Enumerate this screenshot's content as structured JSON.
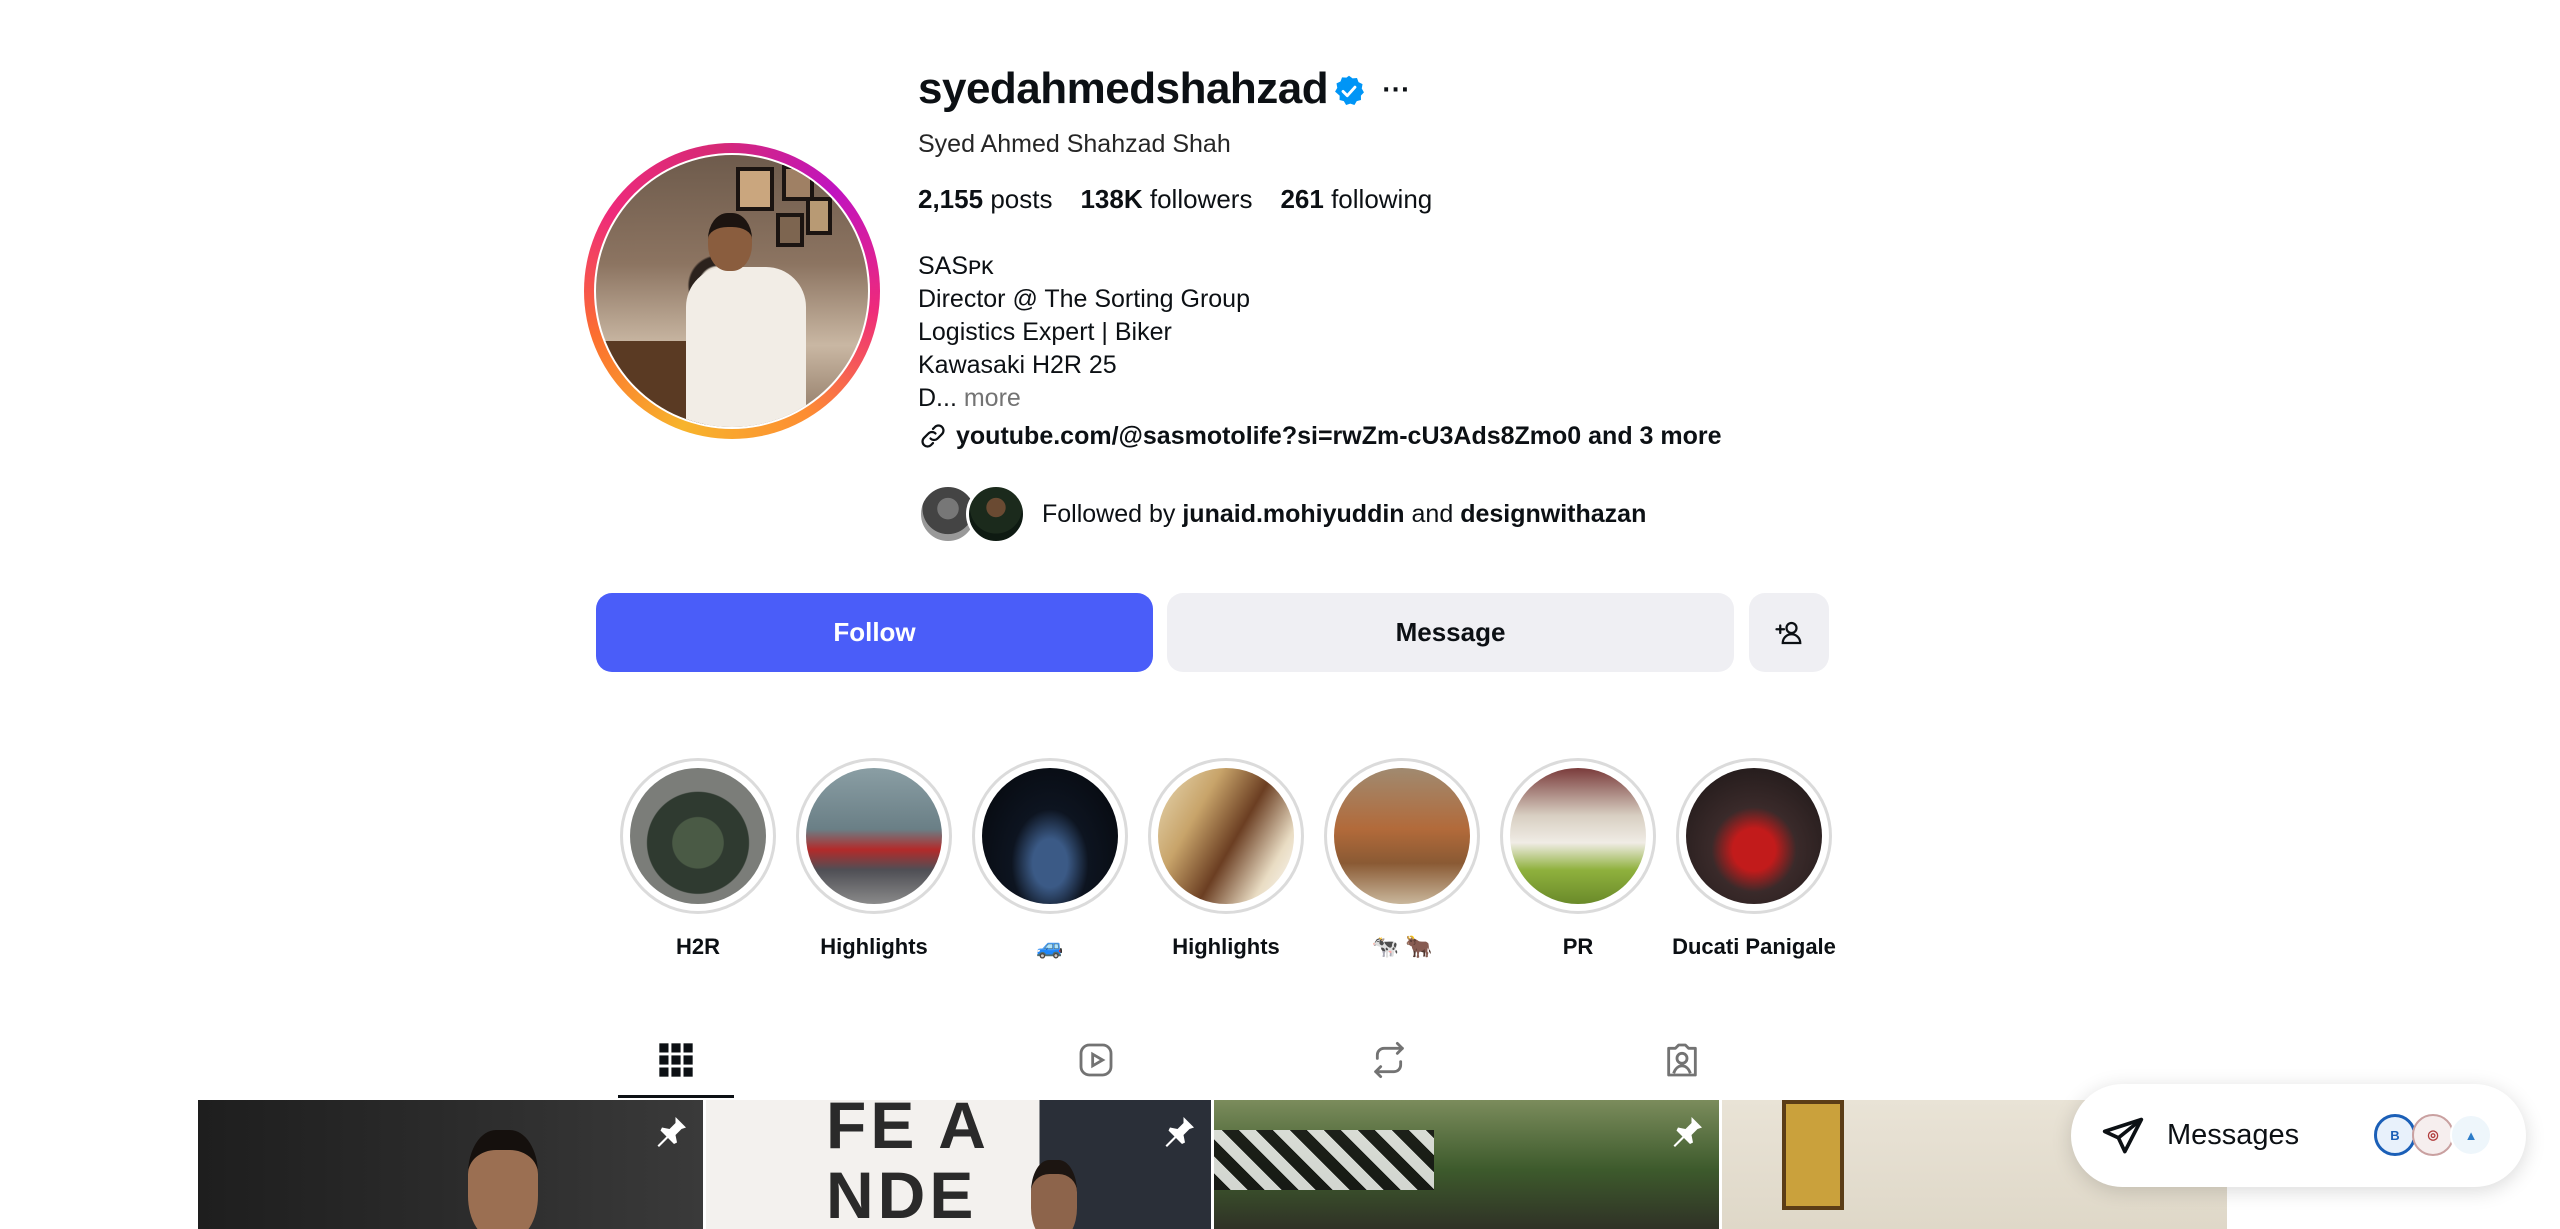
{
  "profile": {
    "username": "syedahmedshahzad",
    "full_name": "Syed Ahmed Shahzad Shah",
    "stats": {
      "posts_count": "2,155",
      "posts_label": "posts",
      "followers_count": "138K",
      "followers_label": "followers",
      "following_count": "261",
      "following_label": "following"
    },
    "bio_lines": [
      "SASᴘᴋ",
      "Director @ The Sorting Group",
      "Logistics Expert | Biker",
      "Kawasaki H2R 25"
    ],
    "bio_truncated": "D...",
    "bio_more": "more",
    "link_text": "youtube.com/@sasmotolife?si=rwZm-cU3Ads8Zmo0 and 3 more",
    "followed_by": {
      "prefix": "Followed by",
      "user1": "junaid.mohiyuddin",
      "joiner": "and",
      "user2": "designwithazan"
    }
  },
  "actions": {
    "follow_label": "Follow",
    "message_label": "Message"
  },
  "highlights": [
    {
      "label": "H2R"
    },
    {
      "label": "Highlights"
    },
    {
      "label": "🚙"
    },
    {
      "label": "Highlights"
    },
    {
      "label": "🐄 🐂"
    },
    {
      "label": "PR"
    },
    {
      "label": "Ducati Panigale"
    }
  ],
  "tabs": [
    {
      "icon": "grid-icon",
      "active": true
    },
    {
      "icon": "reels-icon",
      "active": false
    },
    {
      "icon": "reposts-icon",
      "active": false
    },
    {
      "icon": "tagged-icon",
      "active": false
    }
  ],
  "posts_visible": 4,
  "posts_pinned": [
    true,
    true,
    true,
    false
  ],
  "post_overlay_text": "FE A\nNDE",
  "messages": {
    "label": "Messages"
  },
  "colors": {
    "follow_button": "#4a5df9",
    "secondary_button": "#efeff3",
    "verified_badge": "#0095f6"
  }
}
